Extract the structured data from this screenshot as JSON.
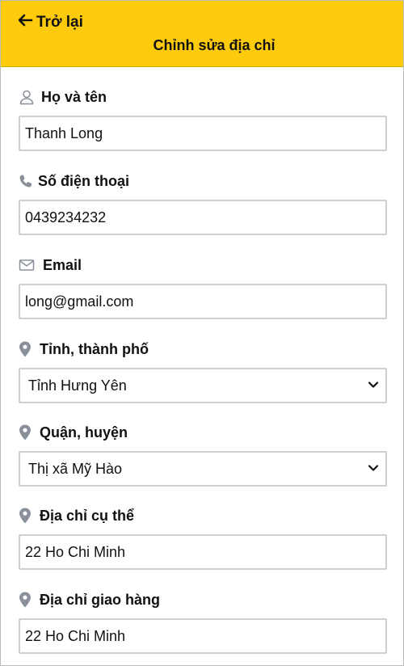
{
  "header": {
    "back_label": "Trở lại",
    "title": "Chỉnh sửa địa chỉ",
    "background": "#fdcb0b"
  },
  "form": {
    "name": {
      "label": "Họ và tên",
      "value": "Thanh Long",
      "icon": "user-icon"
    },
    "phone": {
      "label": "Số điện thoại",
      "value": "0439234232",
      "icon": "phone-icon"
    },
    "email": {
      "label": "Email",
      "value": "long@gmail.com",
      "icon": "envelope-icon"
    },
    "province": {
      "label": "Tỉnh, thành phố",
      "value": "Tỉnh Hưng Yên",
      "icon": "location-icon"
    },
    "district": {
      "label": "Quận, huyện",
      "value": "Thị xã Mỹ Hào",
      "icon": "location-icon"
    },
    "address": {
      "label": "Địa chỉ cụ thể",
      "value": "22 Ho Chi Minh",
      "icon": "location-icon"
    },
    "delivery": {
      "label": "Địa chỉ giao hàng",
      "value": "22 Ho Chi Minh",
      "icon": "location-icon"
    }
  }
}
